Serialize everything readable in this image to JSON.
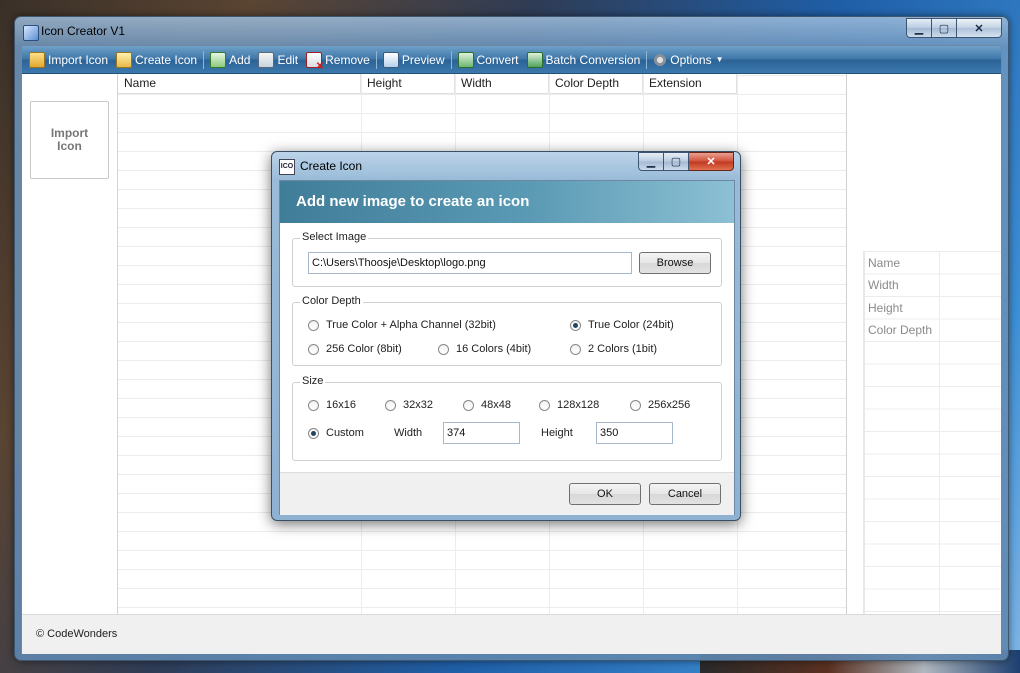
{
  "window": {
    "title": "Icon Creator V1",
    "min_glyph": "▁",
    "max_glyph": "▢",
    "close_glyph": "✕"
  },
  "toolbar": {
    "items": [
      {
        "label": "Import Icon",
        "icon": "folder-icon"
      },
      {
        "label": "Create Icon",
        "icon": "create-icon"
      },
      {
        "label": "Add",
        "icon": "add-icon"
      },
      {
        "label": "Edit",
        "icon": "edit-icon"
      },
      {
        "label": "Remove",
        "icon": "remove-icon"
      },
      {
        "label": "Preview",
        "icon": "preview-icon"
      },
      {
        "label": "Convert",
        "icon": "convert-icon"
      },
      {
        "label": "Batch Conversion",
        "icon": "batch-icon"
      },
      {
        "label": "Options",
        "icon": "gear-icon"
      }
    ],
    "caret": "▼"
  },
  "left_pane": {
    "import_line1": "Import",
    "import_line2": "Icon"
  },
  "grid": {
    "columns": [
      "Name",
      "Height",
      "Width",
      "Color Depth",
      "Extension"
    ]
  },
  "properties": {
    "labels": [
      "Name",
      "Width",
      "Height",
      "Color Depth"
    ]
  },
  "footer": {
    "text": "© CodeWonders"
  },
  "dialog": {
    "title": "Create Icon",
    "icon_text": "ICO",
    "banner": "Add new image to create an icon",
    "select_image": {
      "legend": "Select Image",
      "path_value": "C:\\Users\\Thoosje\\Desktop\\logo.png",
      "browse_label": "Browse"
    },
    "color_depth": {
      "legend": "Color Depth",
      "options": [
        {
          "label": "True Color + Alpha Channel (32bit)",
          "selected": false
        },
        {
          "label": "True Color (24bit)",
          "selected": true
        },
        {
          "label": "256 Color (8bit)",
          "selected": false
        },
        {
          "label": "16 Colors (4bit)",
          "selected": false
        },
        {
          "label": "2 Colors (1bit)",
          "selected": false
        }
      ]
    },
    "size": {
      "legend": "Size",
      "options": [
        {
          "label": "16x16",
          "selected": false
        },
        {
          "label": "32x32",
          "selected": false
        },
        {
          "label": "48x48",
          "selected": false
        },
        {
          "label": "128x128",
          "selected": false
        },
        {
          "label": "256x256",
          "selected": false
        },
        {
          "label": "Custom",
          "selected": true
        }
      ],
      "width_label": "Width",
      "width_value": "374",
      "height_label": "Height",
      "height_value": "350"
    },
    "ok_label": "OK",
    "cancel_label": "Cancel"
  }
}
